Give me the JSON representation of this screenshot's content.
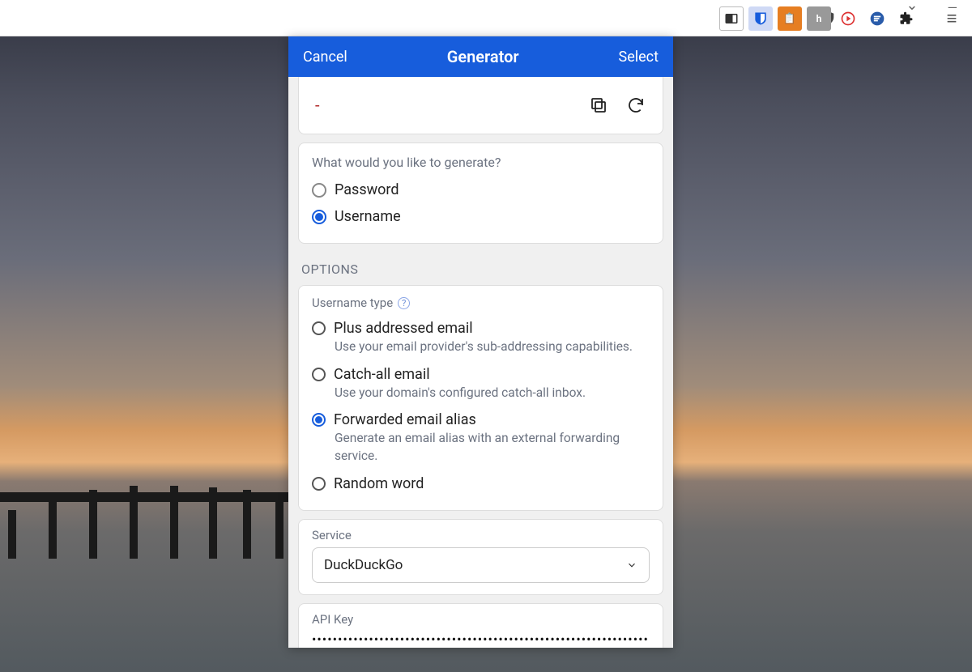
{
  "header": {
    "cancel": "Cancel",
    "title": "Generator",
    "select": "Select"
  },
  "output": {
    "value": "-"
  },
  "generate": {
    "prompt": "What would you like to generate?",
    "options": {
      "password": "Password",
      "username": "Username"
    }
  },
  "sections": {
    "options": "OPTIONS"
  },
  "username_type": {
    "label": "Username type",
    "plus": {
      "title": "Plus addressed email",
      "desc": "Use your email provider's sub-addressing capabilities."
    },
    "catchall": {
      "title": "Catch-all email",
      "desc": "Use your domain's configured catch-all inbox."
    },
    "forwarded": {
      "title": "Forwarded email alias",
      "desc": "Generate an email alias with an external forwarding service."
    },
    "random": {
      "title": "Random word"
    }
  },
  "service": {
    "label": "Service",
    "selected": "DuckDuckGo"
  },
  "api": {
    "label": "API Key",
    "value": "•••••••••••••••••••••••••••••••••••••••••••••••••••••••••••••••••"
  }
}
